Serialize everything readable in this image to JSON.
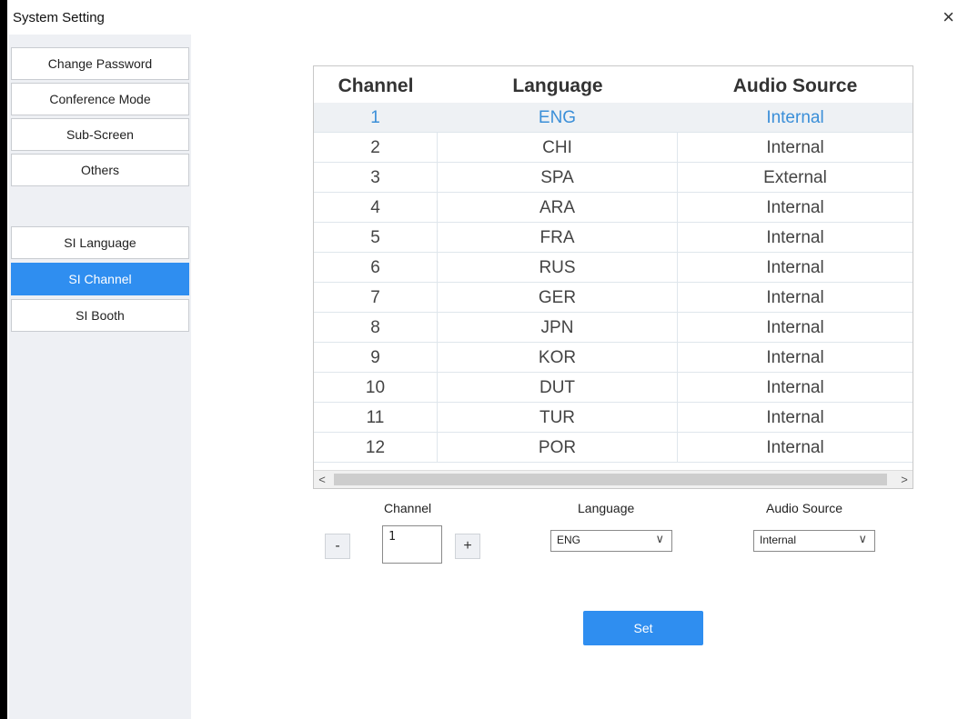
{
  "window": {
    "title": "System Setting",
    "close_glyph": "×"
  },
  "sidebar": {
    "items": [
      {
        "label": "Change Password"
      },
      {
        "label": "Conference Mode"
      },
      {
        "label": "Sub-Screen"
      },
      {
        "label": "Others"
      },
      {
        "label": "SI Language"
      },
      {
        "label": "SI Channel",
        "active": true
      },
      {
        "label": "SI Booth"
      }
    ]
  },
  "table": {
    "headers": [
      "Channel",
      "Language",
      "Audio Source"
    ],
    "rows": [
      [
        "1",
        "ENG",
        "Internal"
      ],
      [
        "2",
        "CHI",
        "Internal"
      ],
      [
        "3",
        "SPA",
        "External"
      ],
      [
        "4",
        "ARA",
        "Internal"
      ],
      [
        "5",
        "FRA",
        "Internal"
      ],
      [
        "6",
        "RUS",
        "Internal"
      ],
      [
        "7",
        "GER",
        "Internal"
      ],
      [
        "8",
        "JPN",
        "Internal"
      ],
      [
        "9",
        "KOR",
        "Internal"
      ],
      [
        "10",
        "DUT",
        "Internal"
      ],
      [
        "11",
        "TUR",
        "Internal"
      ],
      [
        "12",
        "POR",
        "Internal"
      ]
    ],
    "selected_row": 0,
    "scroll_left_glyph": "<",
    "scroll_right_glyph": ">"
  },
  "form": {
    "channel_label": "Channel",
    "language_label": "Language",
    "audio_label": "Audio Source",
    "minus_label": "-",
    "plus_label": "+",
    "channel_value": "1",
    "language_value": "ENG",
    "audio_value": "Internal",
    "chevron_glyph": "∨",
    "set_label": "Set"
  },
  "colors": {
    "accent": "#2f8ef0",
    "selected_text": "#3b8fd8",
    "sidebar_bg": "#eef0f4"
  }
}
